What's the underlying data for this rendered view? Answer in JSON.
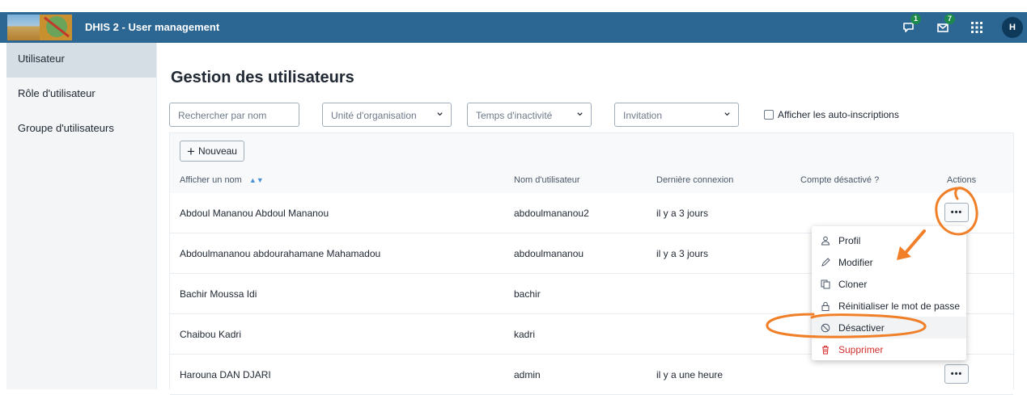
{
  "header": {
    "app_title": "DHIS 2 - User management",
    "interpretations_count": "1",
    "messages_count": "7",
    "avatar_initial": "H",
    "bar_color": "#2c6693"
  },
  "sidebar": {
    "items": [
      {
        "label": "Utilisateur",
        "active": true
      },
      {
        "label": "Rôle d'utilisateur",
        "active": false
      },
      {
        "label": "Groupe d'utilisateurs",
        "active": false
      }
    ]
  },
  "main": {
    "title": "Gestion des utilisateurs",
    "search_placeholder": "Rechercher par nom",
    "filters": {
      "org_unit": "Unité d'organisation",
      "inactivity": "Temps d'inactivité",
      "invitation": "Invitation"
    },
    "self_registrations_label": "Afficher les auto-inscriptions",
    "new_button": "Nouveau"
  },
  "table": {
    "columns": {
      "name": "Afficher un nom",
      "username": "Nom d'utilisateur",
      "last_login": "Dernière connexion",
      "disabled": "Compte désactivé ?",
      "actions": "Actions"
    },
    "rows": [
      {
        "name": "Abdoul Mananou Abdoul Mananou",
        "username": "abdoulmananou2",
        "last_login": "il y a 3 jours",
        "disabled": ""
      },
      {
        "name": "Abdoulmananou abdourahamane Mahamadou",
        "username": "abdoulmananou",
        "last_login": "il y a 3 jours",
        "disabled": ""
      },
      {
        "name": "Bachir Moussa Idi",
        "username": "bachir",
        "last_login": "",
        "disabled": ""
      },
      {
        "name": "Chaibou Kadri",
        "username": "kadri",
        "last_login": "",
        "disabled": ""
      },
      {
        "name": "Harouna DAN DJARI",
        "username": "admin",
        "last_login": "il y a une heure",
        "disabled": ""
      }
    ]
  },
  "context_menu": {
    "items": [
      {
        "label": "Profil",
        "icon": "user-icon"
      },
      {
        "label": "Modifier",
        "icon": "pencil-icon"
      },
      {
        "label": "Cloner",
        "icon": "copy-icon"
      },
      {
        "label": "Réinitialiser le mot de passe",
        "icon": "lock-icon"
      },
      {
        "label": "Désactiver",
        "icon": "block-icon"
      },
      {
        "label": "Supprimer",
        "icon": "trash-icon",
        "color": "#d32f2f"
      }
    ]
  },
  "annotation_color": "#f07f28"
}
